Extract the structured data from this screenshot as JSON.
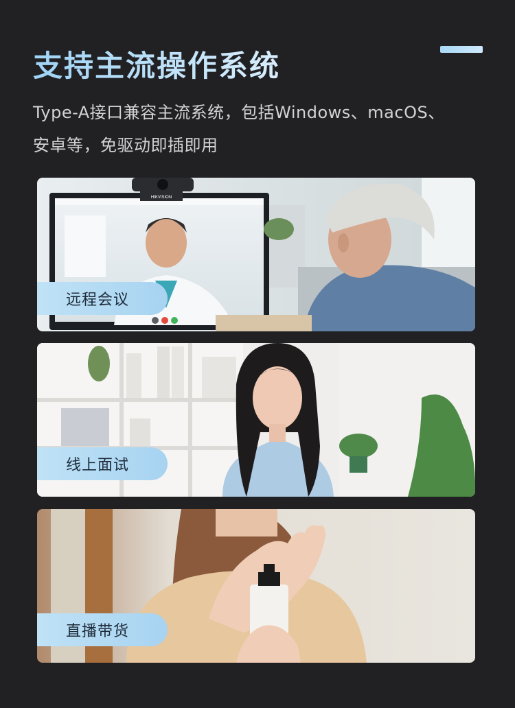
{
  "header": {
    "title": "支持主流操作系统",
    "description_line1": "Type-A接口兼容主流系统，包括Windows、macOS、",
    "description_line2": "安卓等，免驱动即插即用"
  },
  "cards": [
    {
      "label": "远程会议",
      "monitor_brand": "HIKVISION"
    },
    {
      "label": "线上面试"
    },
    {
      "label": "直播带货"
    }
  ],
  "colors": {
    "background": "#212124",
    "title_gradient_start": "#9fd3f5",
    "title_gradient_end": "#d9eefc",
    "pill": "#b4daf4"
  }
}
